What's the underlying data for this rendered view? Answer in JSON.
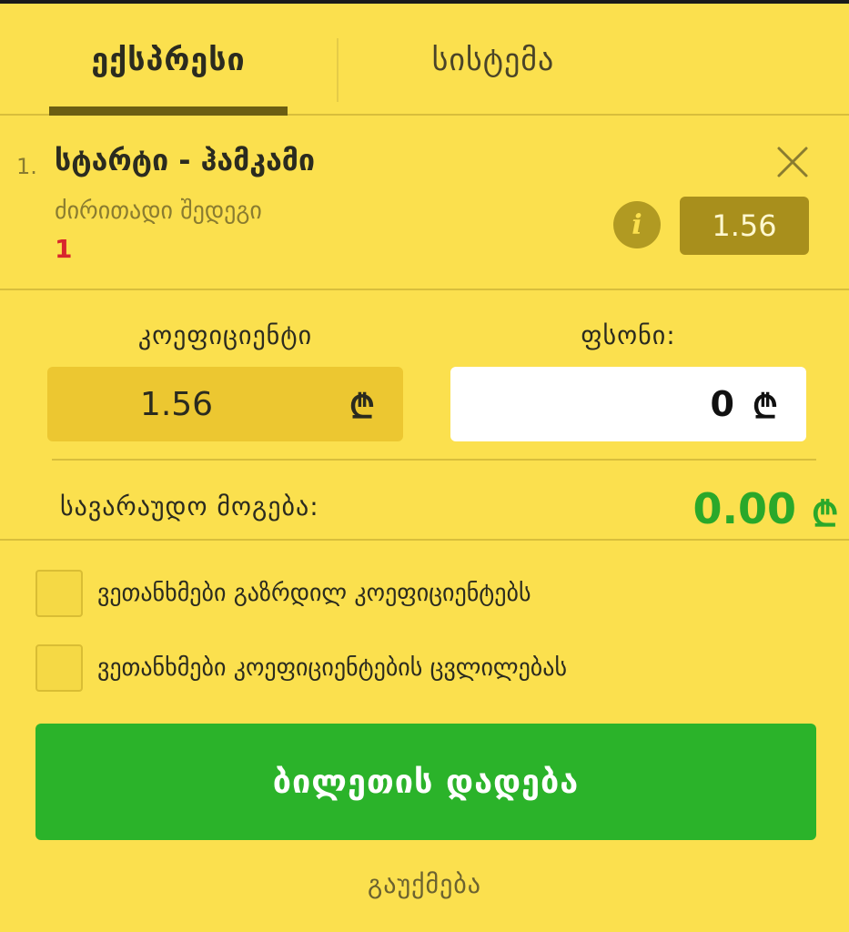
{
  "tabs": {
    "express": "ექსპრესი",
    "system": "სისტემა"
  },
  "selection": {
    "number": "1.",
    "title": "სტარტი - ჰამკამი",
    "market": "ძირითადი შედეგი",
    "outcome": "1",
    "odd": "1.56",
    "info_icon": "i"
  },
  "bet": {
    "coefficient_label": "კოეფიციენტი",
    "stake_label": "ფსონი:",
    "coefficient_value": "1.56",
    "stake_value": "0",
    "currency_symbol": "₾",
    "possible_win_label": "სავარაუდო მოგება:",
    "possible_win_value": "0.00"
  },
  "options": {
    "accept_increased": "ვეთანხმები გაზრდილ კოეფიციენტებს",
    "accept_changes": "ვეთანხმები კოეფიციენტების ცვლილებას"
  },
  "actions": {
    "place_bet": "ბილეთის დადება",
    "cancel": "გაუქმება"
  },
  "colors": {
    "background": "#fbe04e",
    "accent_green": "#2bb32a",
    "odd_badge": "#a88f1c",
    "outcome_red": "#d8262d"
  }
}
